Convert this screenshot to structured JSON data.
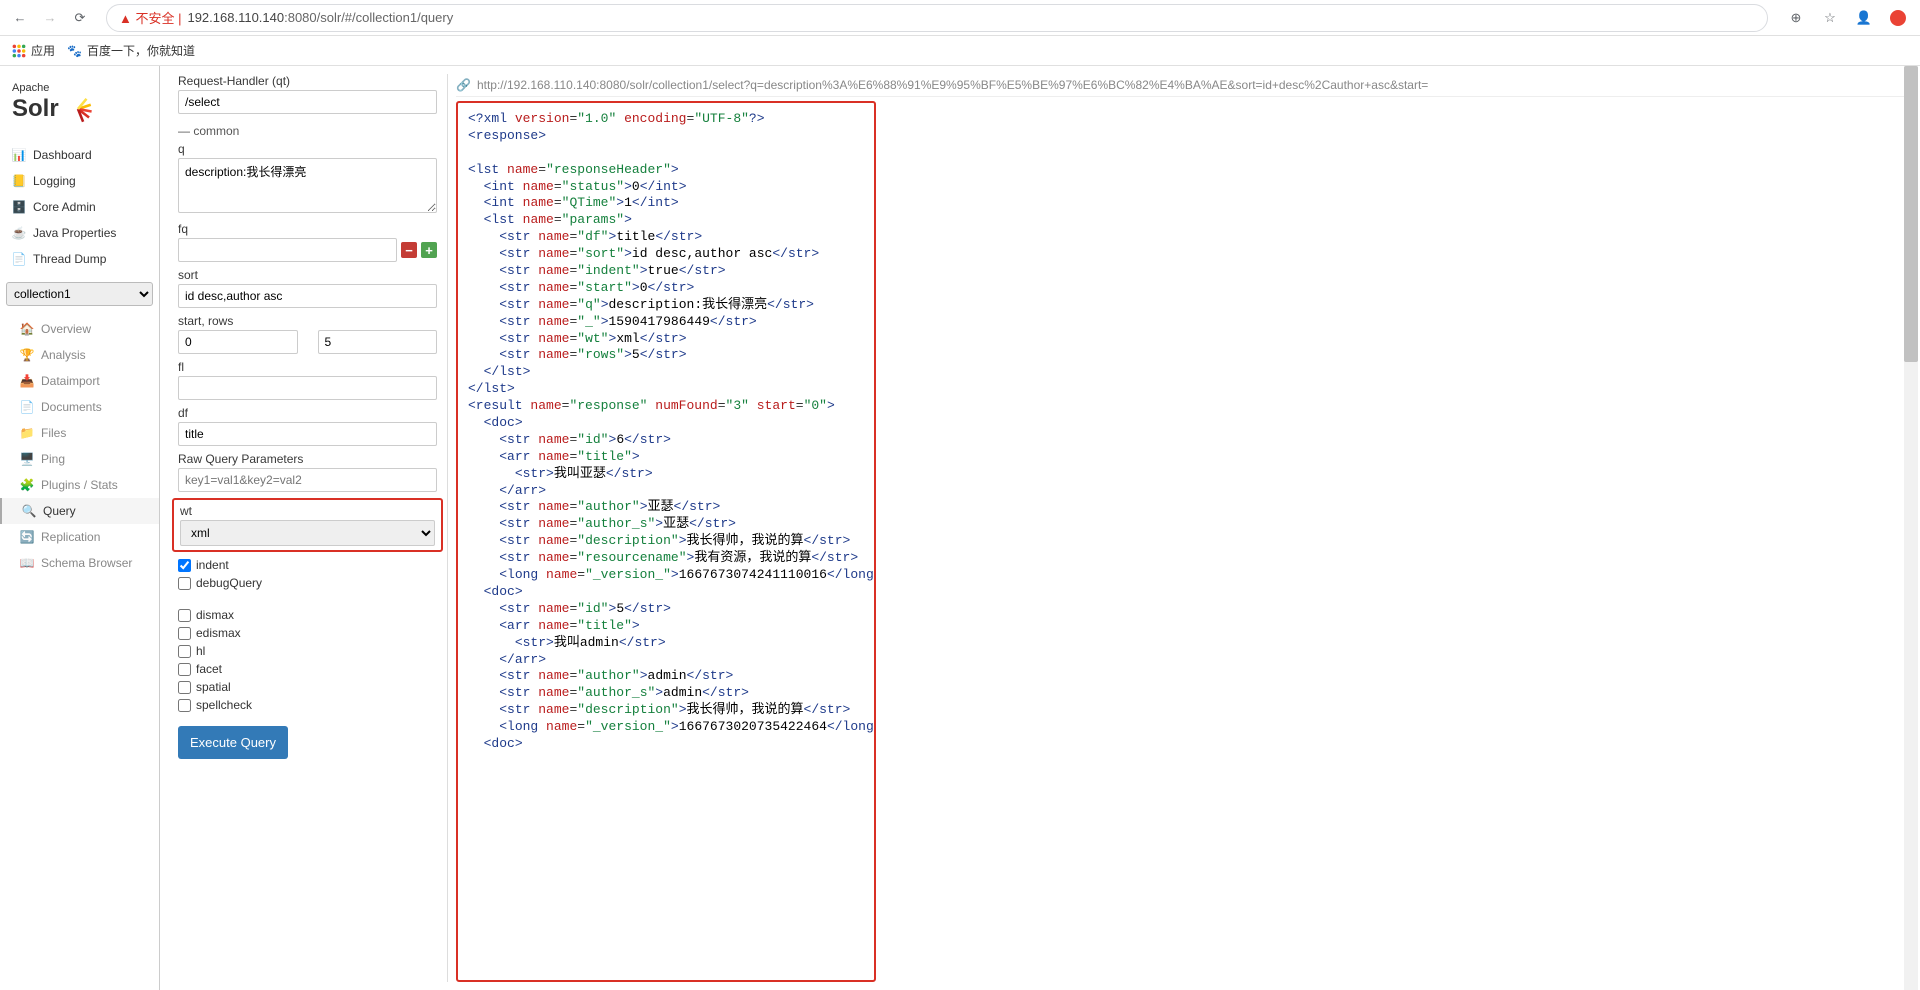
{
  "browser": {
    "url_warn": "▲ 不安全 |",
    "url_host": "192.168.110.140",
    "url_port_path": ":8080/solr/#/collection1/query"
  },
  "bookmarks": {
    "apps": "应用",
    "baidu": "百度一下，你就知道"
  },
  "logo": {
    "apache": "Apache",
    "solr": "Solr"
  },
  "nav": {
    "dashboard": "Dashboard",
    "logging": "Logging",
    "core_admin": "Core Admin",
    "java_props": "Java Properties",
    "thread_dump": "Thread Dump"
  },
  "core_selected": "collection1",
  "subnav": {
    "overview": "Overview",
    "analysis": "Analysis",
    "dataimport": "Dataimport",
    "documents": "Documents",
    "files": "Files",
    "ping": "Ping",
    "plugins": "Plugins / Stats",
    "query": "Query",
    "replication": "Replication",
    "schema": "Schema Browser"
  },
  "form": {
    "qt_label": "Request-Handler (qt)",
    "qt_value": "/select",
    "common": "common",
    "q_label": "q",
    "q_value": "description:我长得漂亮",
    "fq_label": "fq",
    "sort_label": "sort",
    "sort_value": "id desc,author asc",
    "startrows_label": "start, rows",
    "start_value": "0",
    "rows_value": "5",
    "fl_label": "fl",
    "df_label": "df",
    "df_value": "title",
    "rawq_label": "Raw Query Parameters",
    "rawq_placeholder": "key1=val1&key2=val2",
    "wt_label": "wt",
    "wt_value": "xml",
    "indent": "indent",
    "debugQuery": "debugQuery",
    "dismax": "dismax",
    "edismax": "edismax",
    "hl": "hl",
    "facet": "facet",
    "spatial": "spatial",
    "spellcheck": "spellcheck",
    "execute": "Execute Query"
  },
  "result_url": "http://192.168.110.140:8080/solr/collection1/select?q=description%3A%E6%88%91%E9%95%BF%E5%BE%97%E6%BC%82%E4%BA%AE&sort=id+desc%2Cauthor+asc&start=",
  "xml": {
    "decl": "<?xml version=\"1.0\" encoding=\"UTF-8\"?>",
    "header": {
      "status": "0",
      "qtime": "1",
      "params": {
        "df": "title",
        "sort": "id desc,author asc",
        "indent": "true",
        "start": "0",
        "q": "description:我长得漂亮",
        "_": "1590417986449",
        "wt": "xml",
        "rows": "5"
      }
    },
    "result": {
      "numFound": "3",
      "start": "0",
      "docs": [
        {
          "id": "6",
          "title": "我叫亚瑟",
          "author": "亚瑟",
          "author_s": "亚瑟",
          "description": "我长得帅，我说的算",
          "resourcename": "我有资源，我说的算",
          "_version_": "1667673074241110016"
        },
        {
          "id": "5",
          "title": "我叫admin",
          "author": "admin",
          "author_s": "admin",
          "description": "我长得帅，我说的算",
          "_version_": "1667673020735422464"
        }
      ]
    }
  }
}
